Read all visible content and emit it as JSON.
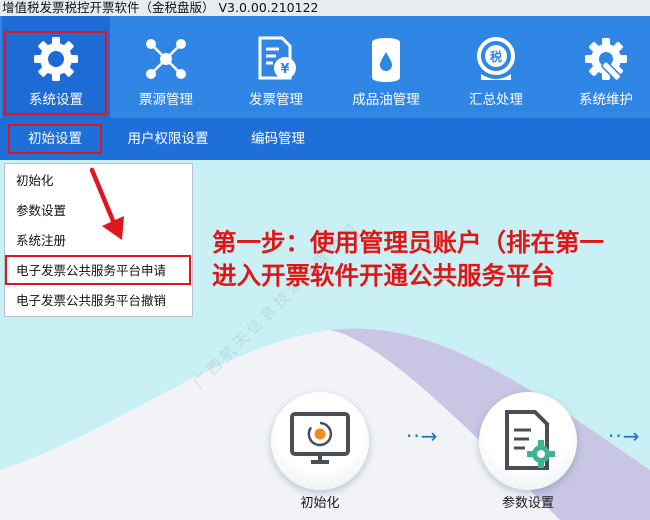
{
  "window": {
    "title": "增值税发票税控开票软件（金税盘版） V3.0.00.210122"
  },
  "toolbar": {
    "items": [
      {
        "label": "系统设置",
        "icon": "gear-icon"
      },
      {
        "label": "票源管理",
        "icon": "network-nodes-icon"
      },
      {
        "label": "发票管理",
        "icon": "invoice-yen-icon"
      },
      {
        "label": "成品油管理",
        "icon": "oil-barrel-icon"
      },
      {
        "label": "汇总处理",
        "icon": "tax-summary-icon"
      },
      {
        "label": "系统维护",
        "icon": "wrench-gear-icon"
      }
    ]
  },
  "subtabs": [
    {
      "label": "初始设置"
    },
    {
      "label": "用户权限设置"
    },
    {
      "label": "编码管理"
    }
  ],
  "dropdown": {
    "items": [
      {
        "label": "初始化"
      },
      {
        "label": "参数设置"
      },
      {
        "label": "系统注册"
      },
      {
        "label": "电子发票公共服务平台申请"
      },
      {
        "label": "电子发票公共服务平台撤销"
      }
    ]
  },
  "annotation": {
    "line1": "第一步：使用管理员账户（排在第一",
    "line2": "进入开票软件开通公共服务平台"
  },
  "workflow": {
    "steps": [
      {
        "label": "初始化",
        "icon": "monitor-init-icon"
      },
      {
        "label": "参数设置",
        "icon": "doc-gear-icon"
      }
    ],
    "arrow_glyph": "··→"
  },
  "watermark": {
    "text": "广西航天信息技术有限公司"
  },
  "colors": {
    "toolbar_bg": "#2f86e4",
    "subbar_bg": "#1f6fd8",
    "content_bg": "#c9f0f4",
    "highlight": "#e0161e",
    "annotation": "#e01515"
  }
}
